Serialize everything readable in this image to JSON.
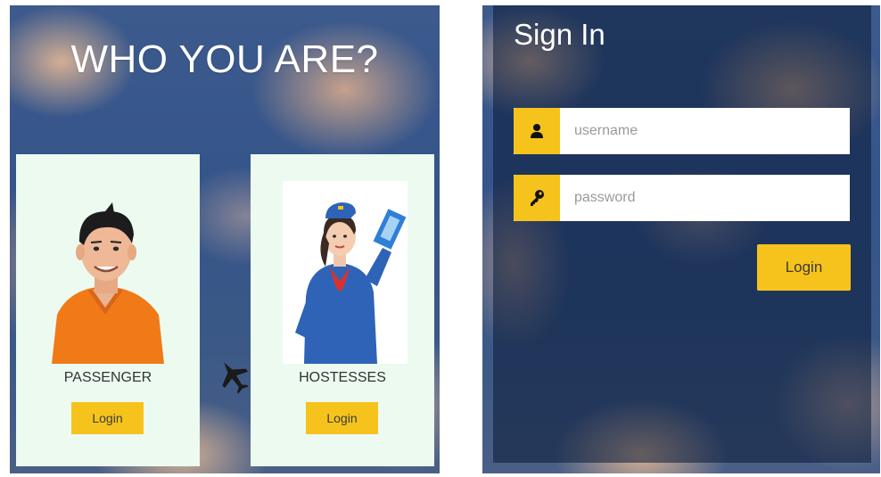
{
  "role_select": {
    "title": "WHO YOU ARE?",
    "roles": [
      {
        "label": "PASSENGER",
        "login_label": "Login",
        "figure": "passenger-illustration"
      },
      {
        "label": "HOSTESSES",
        "login_label": "Login",
        "figure": "hostess-illustration"
      }
    ]
  },
  "sign_in": {
    "title": "Sign In",
    "username": {
      "placeholder": "username",
      "value": "",
      "icon": "user-icon"
    },
    "password": {
      "placeholder": "password",
      "value": "",
      "icon": "key-icon"
    },
    "login_label": "Login"
  },
  "colors": {
    "accent": "#f6c31c",
    "card_bg": "#ecfaf0",
    "sky": "#3c5a8c"
  }
}
